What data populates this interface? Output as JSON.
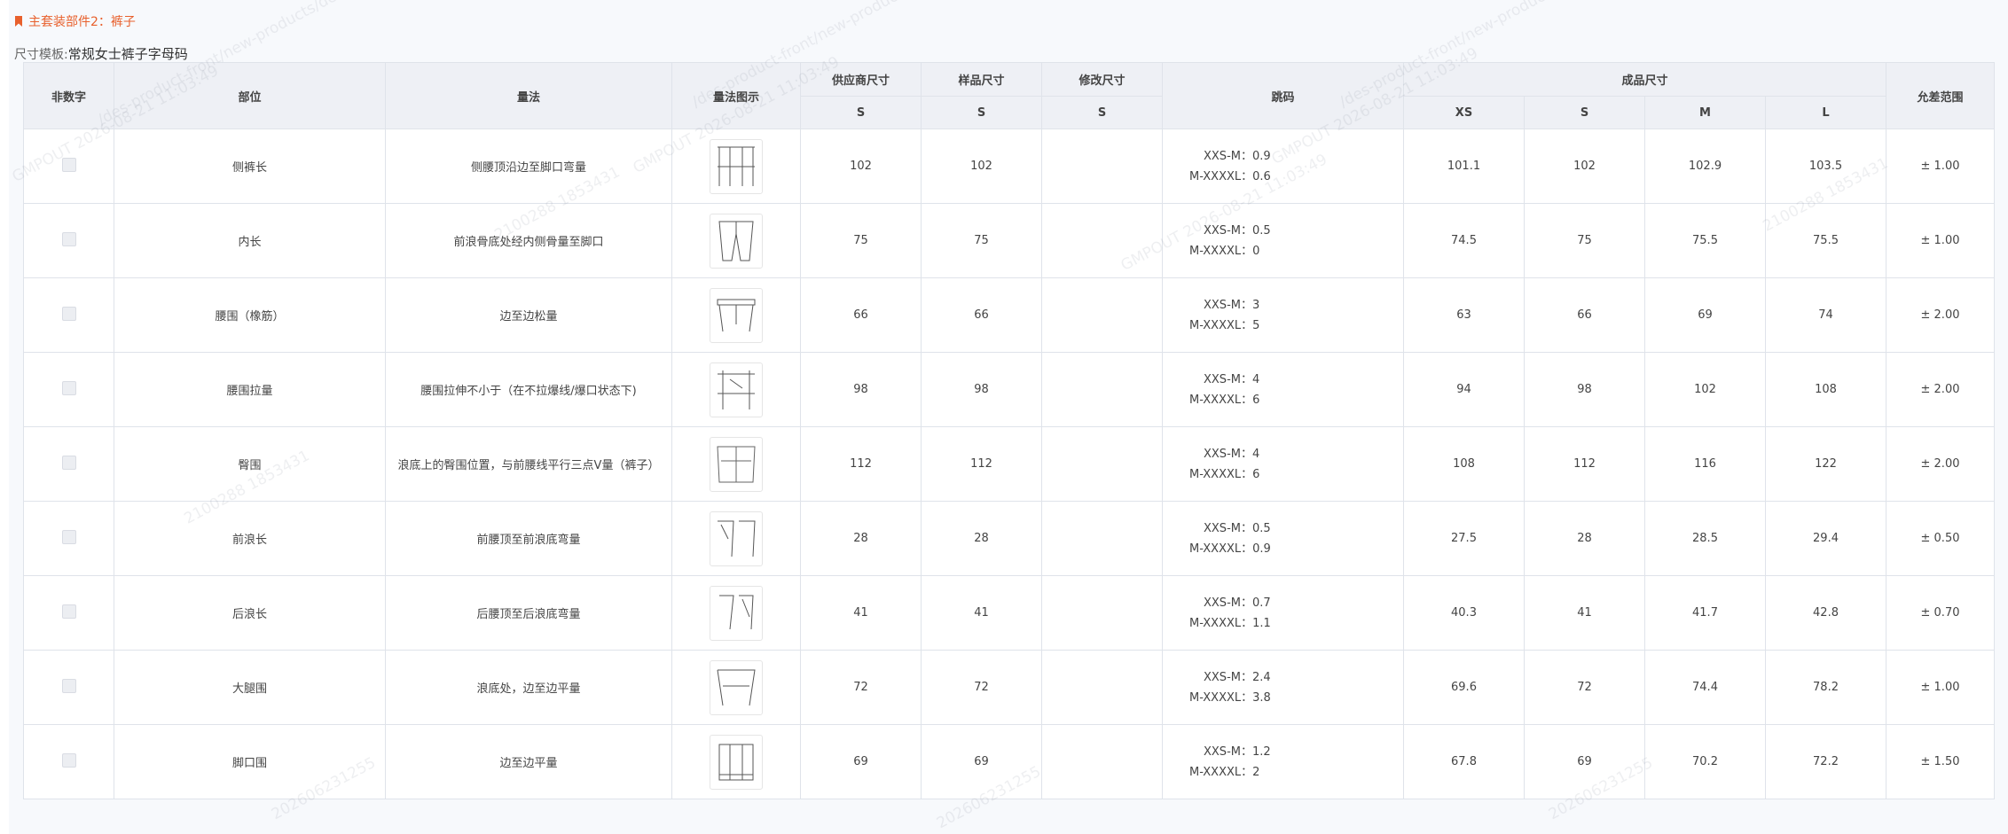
{
  "section": {
    "title": "主套装部件2：裤子",
    "icon": "bookmark-icon",
    "accent_color": "#e8602c"
  },
  "template": {
    "label": "尺寸模板:",
    "value": "常规女士裤子字母码"
  },
  "table": {
    "headers": {
      "nondigit": "非数字",
      "part": "部位",
      "method": "量法",
      "diagram": "量法图示",
      "supplier": "供应商尺寸",
      "sample": "样品尺寸",
      "modify": "修改尺寸",
      "jump": "跳码",
      "finished": "成品尺寸",
      "tolerance": "允差范围",
      "supplier_size": "S",
      "sample_size": "S",
      "modify_size": "S",
      "finished_sizes": [
        "XS",
        "S",
        "M",
        "L"
      ]
    },
    "rows": [
      {
        "part": "侧裤长",
        "method": "侧腰顶沿边至脚口弯量",
        "supplier": "102",
        "sample": "102",
        "modify": "",
        "jump1": "XXS-M：0.9",
        "jump2": "M-XXXXL：0.6",
        "xs": "101.1",
        "s": "102",
        "m": "102.9",
        "l": "103.5",
        "tol": "± 1.00"
      },
      {
        "part": "内长",
        "method": "前浪骨底处经内侧骨量至脚口",
        "supplier": "75",
        "sample": "75",
        "modify": "",
        "jump1": "XXS-M：0.5",
        "jump2": "M-XXXXL：0",
        "xs": "74.5",
        "s": "75",
        "m": "75.5",
        "l": "75.5",
        "tol": "± 1.00"
      },
      {
        "part": "腰围（橡筋）",
        "method": "边至边松量",
        "supplier": "66",
        "sample": "66",
        "modify": "",
        "jump1": "XXS-M：3",
        "jump2": "M-XXXXL：5",
        "xs": "63",
        "s": "66",
        "m": "69",
        "l": "74",
        "tol": "± 2.00"
      },
      {
        "part": "腰围拉量",
        "method": "腰围拉伸不小于（在不拉爆线/爆口状态下)",
        "supplier": "98",
        "sample": "98",
        "modify": "",
        "jump1": "XXS-M：4",
        "jump2": "M-XXXXL：6",
        "xs": "94",
        "s": "98",
        "m": "102",
        "l": "108",
        "tol": "± 2.00"
      },
      {
        "part": "臀围",
        "method": "浪底上的臀围位置，与前腰线平行三点V量（裤子）",
        "supplier": "112",
        "sample": "112",
        "modify": "",
        "jump1": "XXS-M：4",
        "jump2": "M-XXXXL：6",
        "xs": "108",
        "s": "112",
        "m": "116",
        "l": "122",
        "tol": "± 2.00"
      },
      {
        "part": "前浪长",
        "method": "前腰顶至前浪底弯量",
        "supplier": "28",
        "sample": "28",
        "modify": "",
        "jump1": "XXS-M：0.5",
        "jump2": "M-XXXXL：0.9",
        "xs": "27.5",
        "s": "28",
        "m": "28.5",
        "l": "29.4",
        "tol": "± 0.50"
      },
      {
        "part": "后浪长",
        "method": "后腰顶至后浪底弯量",
        "supplier": "41",
        "sample": "41",
        "modify": "",
        "jump1": "XXS-M：0.7",
        "jump2": "M-XXXXL：1.1",
        "xs": "40.3",
        "s": "41",
        "m": "41.7",
        "l": "42.8",
        "tol": "± 0.70"
      },
      {
        "part": "大腿围",
        "method": "浪底处，边至边平量",
        "supplier": "72",
        "sample": "72",
        "modify": "",
        "jump1": "XXS-M：2.4",
        "jump2": "M-XXXXL：3.8",
        "xs": "69.6",
        "s": "72",
        "m": "74.4",
        "l": "78.2",
        "tol": "± 1.00"
      },
      {
        "part": "脚口围",
        "method": "边至边平量",
        "supplier": "69",
        "sample": "69",
        "modify": "",
        "jump1": "XXS-M：1.2",
        "jump2": "M-XXXXL：2",
        "xs": "67.8",
        "s": "69",
        "m": "70.2",
        "l": "72.2",
        "tol": "± 1.50"
      }
    ]
  },
  "watermarks": [
    "GMPOUT 2026-08-21 11:03:49",
    "/des-product-front/new-products/detail-new",
    "2100288 1853431",
    "202606231255"
  ]
}
